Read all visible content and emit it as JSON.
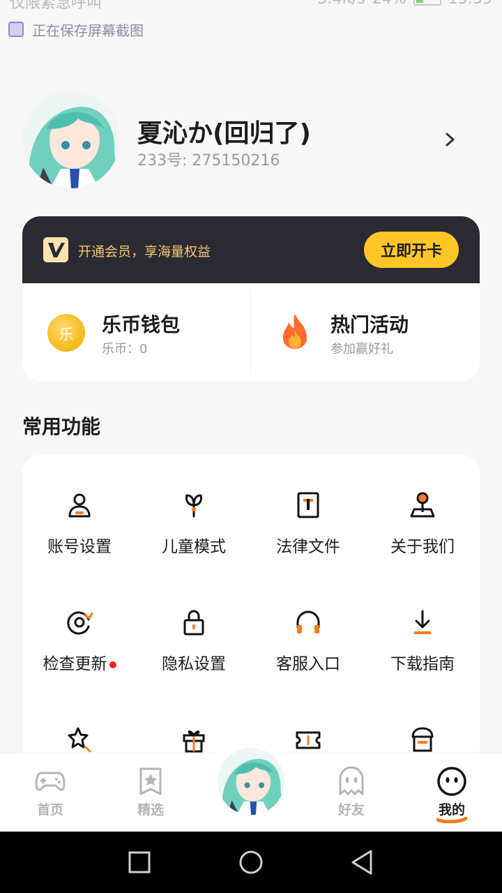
{
  "status_bar": {
    "left_text": "仅限紧急呼叫",
    "right_text": "3.4K/s",
    "battery": "24%",
    "time": "15:59"
  },
  "notification": {
    "text": "正在保存屏幕截图"
  },
  "profile": {
    "nickname": "夏沁か(回归了)",
    "uid": "233号: 275150216"
  },
  "vip": {
    "text": "开通会员，享海量权益",
    "button": "立即开卡"
  },
  "wallet": {
    "title": "乐币钱包",
    "sub": "乐币：0",
    "coin_glyph": "乐"
  },
  "event": {
    "title": "热门活动",
    "sub": "参加赢好礼"
  },
  "section": {
    "title": "常用功能"
  },
  "functions": [
    {
      "label": "账号设置",
      "icon": "user-icon"
    },
    {
      "label": "儿童模式",
      "icon": "sprout-icon"
    },
    {
      "label": "法律文件",
      "icon": "document-icon"
    },
    {
      "label": "关于我们",
      "icon": "joystick-icon"
    },
    {
      "label": "检查更新",
      "icon": "refresh-icon"
    },
    {
      "label": "隐私设置",
      "icon": "lock-icon"
    },
    {
      "label": "客服入口",
      "icon": "headphones-icon"
    },
    {
      "label": "下载指南",
      "icon": "download-icon"
    }
  ],
  "bottom_nav": [
    {
      "label": "首页",
      "icon": "gamepad-icon"
    },
    {
      "label": "精选",
      "icon": "star-bookmark-icon"
    },
    {
      "label": "好友",
      "icon": "ghost-icon"
    },
    {
      "label": "我的",
      "icon": "smiley-icon",
      "active": true
    }
  ],
  "colors": {
    "accent": "#ffc625",
    "orange": "#ff7a1a",
    "dark_bar": "#2b2a33",
    "badge_red": "#ff1f1f"
  }
}
